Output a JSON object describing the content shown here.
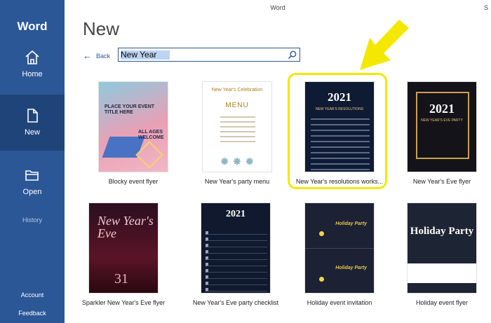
{
  "app": {
    "window_title": "Word",
    "user_initial": "S",
    "brand": "Word"
  },
  "sidebar": {
    "home": "Home",
    "new": "New",
    "open": "Open",
    "history": "History",
    "account": "Account",
    "feedback": "Feedback"
  },
  "page": {
    "title": "New",
    "back_label": "Back"
  },
  "search": {
    "value": "New Year",
    "placeholder": ""
  },
  "templates": [
    {
      "label": "Blocky event flyer"
    },
    {
      "label": "New Year's party menu"
    },
    {
      "label": "New Year's resolutions works..."
    },
    {
      "label": "New Year's Eve flyer"
    },
    {
      "label": "Sparkler New Year's Eve flyer"
    },
    {
      "label": "New Year's Eve party checklist"
    },
    {
      "label": "Holiday event invitation"
    },
    {
      "label": "Holiday event flyer"
    }
  ],
  "thumbs": {
    "blocky_title": "PLACE YOUR EVENT TITLE HERE",
    "blocky_sub": "ALL AGES WELCOME",
    "menu_title": "New Year's Celebration",
    "menu_head": "MENU",
    "resolution_year": "2021",
    "resolution_sub": "NEW YEAR'S RESOLUTIONS",
    "eve_year": "2021",
    "eve_sub": "NEW YEAR'S EVE PARTY",
    "sparkler_title": "New Year's Eve",
    "sparkler_date": "31",
    "checklist_year": "2021",
    "invite_title": "Holiday Party",
    "holiday_title": "Holiday Party"
  },
  "colors": {
    "sidebar": "#2b5797",
    "highlight": "#f5e800",
    "accent": "#2b5797"
  }
}
